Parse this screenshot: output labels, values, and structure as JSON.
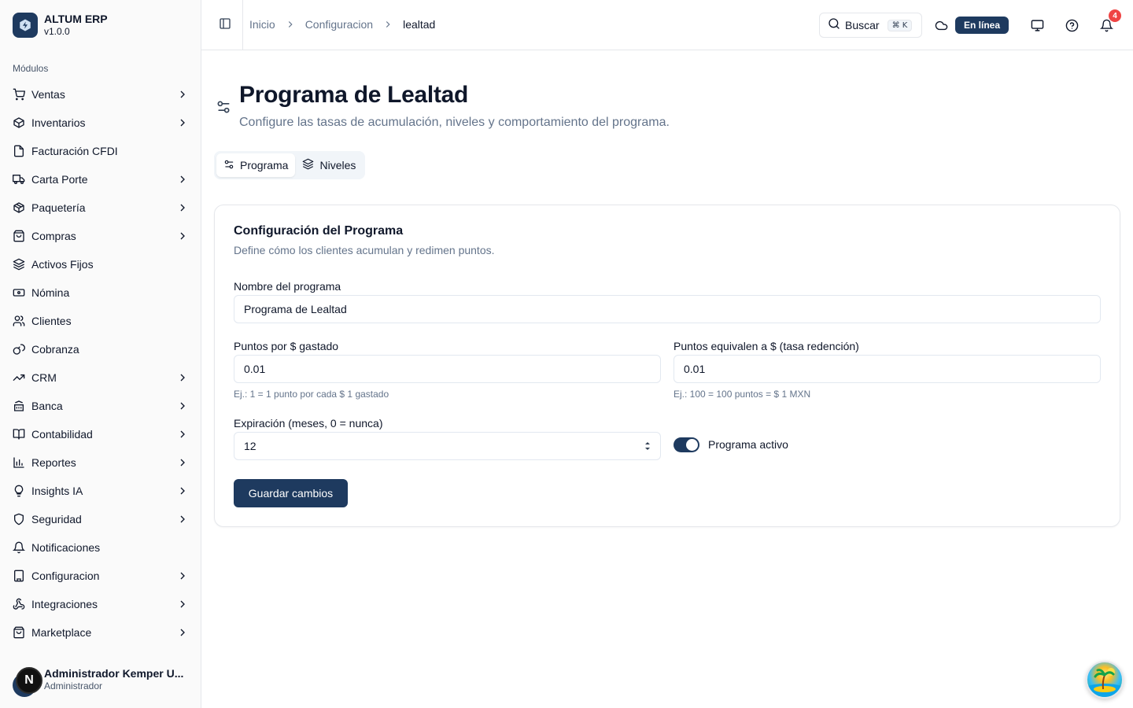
{
  "brand": {
    "name": "ALTUM ERP",
    "version": "v1.0.0"
  },
  "sidebar": {
    "section_label": "Módulos",
    "items": [
      {
        "label": "Ventas",
        "icon": "cart-icon",
        "has_children": true
      },
      {
        "label": "Inventarios",
        "icon": "package-icon",
        "has_children": true
      },
      {
        "label": "Facturación CFDI",
        "icon": "file-icon",
        "has_children": false
      },
      {
        "label": "Carta Porte",
        "icon": "truck-icon",
        "has_children": true
      },
      {
        "label": "Paquetería",
        "icon": "box-icon",
        "has_children": true
      },
      {
        "label": "Compras",
        "icon": "shopping-bag-icon",
        "has_children": true
      },
      {
        "label": "Activos Fijos",
        "icon": "layers-icon",
        "has_children": false
      },
      {
        "label": "Nómina",
        "icon": "banknote-icon",
        "has_children": false
      },
      {
        "label": "Clientes",
        "icon": "users-icon",
        "has_children": false
      },
      {
        "label": "Cobranza",
        "icon": "coins-icon",
        "has_children": false
      },
      {
        "label": "CRM",
        "icon": "trending-up-icon",
        "has_children": true
      },
      {
        "label": "Banca",
        "icon": "bank-icon",
        "has_children": true
      },
      {
        "label": "Contabilidad",
        "icon": "book-icon",
        "has_children": true
      },
      {
        "label": "Reportes",
        "icon": "bar-chart-icon",
        "has_children": true
      },
      {
        "label": "Insights IA",
        "icon": "lightbulb-icon",
        "has_children": true
      },
      {
        "label": "Seguridad",
        "icon": "shield-icon",
        "has_children": true
      },
      {
        "label": "Notificaciones",
        "icon": "bell-icon",
        "has_children": false
      },
      {
        "label": "Configuracion",
        "icon": "building-icon",
        "has_children": true
      },
      {
        "label": "Integraciones",
        "icon": "webhook-icon",
        "has_children": true
      },
      {
        "label": "Marketplace",
        "icon": "store-icon",
        "has_children": true
      }
    ],
    "user": {
      "name": "Administrador Kemper U...",
      "role": "Administrador",
      "initial": "N"
    }
  },
  "header": {
    "breadcrumb": [
      "Inicio",
      "Configuracion",
      "lealtad"
    ],
    "search_label": "Buscar",
    "search_shortcut": "⌘ K",
    "status": "En línea",
    "notifications_count": "4"
  },
  "page": {
    "title": "Programa de Lealtad",
    "subtitle": "Configure las tasas de acumulación, niveles y comportamiento del programa.",
    "tabs": [
      {
        "label": "Programa",
        "active": true
      },
      {
        "label": "Niveles",
        "active": false
      }
    ]
  },
  "form": {
    "card_title": "Configuración del Programa",
    "card_description": "Define cómo los clientes acumulan y redimen puntos.",
    "program_name_label": "Nombre del programa",
    "program_name_value": "Programa de Lealtad",
    "points_per_label": "Puntos por $ gastado",
    "points_per_value": "0.01",
    "points_per_hint": "Ej.: 1 = 1 punto por cada $ 1 gastado",
    "redemption_label": "Puntos equivalen a $ (tasa redención)",
    "redemption_value": "0.01",
    "redemption_hint": "Ej.: 100 = 100 puntos = $ 1 MXN",
    "expiration_label": "Expiración (meses, 0 = nunca)",
    "expiration_value": "12",
    "active_label": "Programa activo",
    "active_on": true,
    "save_label": "Guardar cambios"
  },
  "colors": {
    "primary": "#1e3a5f",
    "danger": "#ef4444",
    "muted_text": "#64748b"
  }
}
